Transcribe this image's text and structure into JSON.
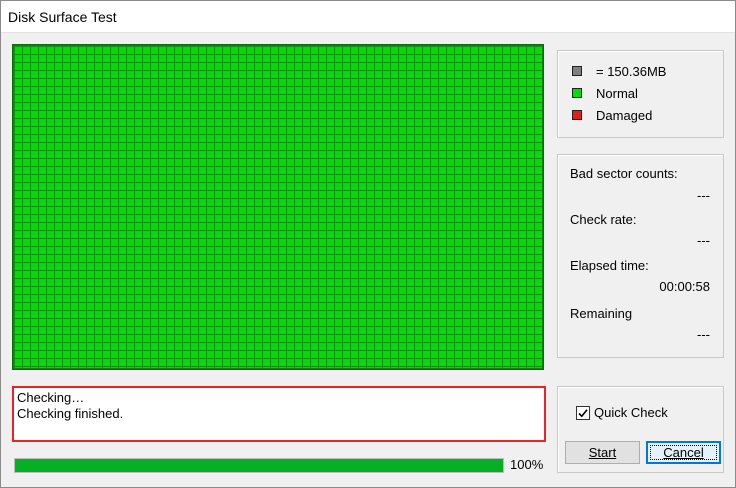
{
  "window": {
    "title": "Disk Surface Test"
  },
  "legend": [
    {
      "label": "= 150.36MB",
      "color": "#808080"
    },
    {
      "label": "Normal",
      "color": "#00e000"
    },
    {
      "label": "Damaged",
      "color": "#e02020"
    }
  ],
  "stats": [
    {
      "label": "Bad sector counts:",
      "value": "---"
    },
    {
      "label": "Check rate:",
      "value": "---"
    },
    {
      "label": "Elapsed time:",
      "value": "00:00:58"
    },
    {
      "label": "Remaining",
      "value": "---"
    }
  ],
  "log": {
    "lines": [
      "Checking…",
      "Checking finished."
    ]
  },
  "progress": {
    "percent": 100,
    "text": "100%"
  },
  "controls": {
    "quick_check_label": "Quick Check",
    "quick_check_checked": true,
    "start_label": "Start",
    "cancel_label": "Cancel"
  },
  "surface": {
    "status_color": "#00dd00"
  }
}
